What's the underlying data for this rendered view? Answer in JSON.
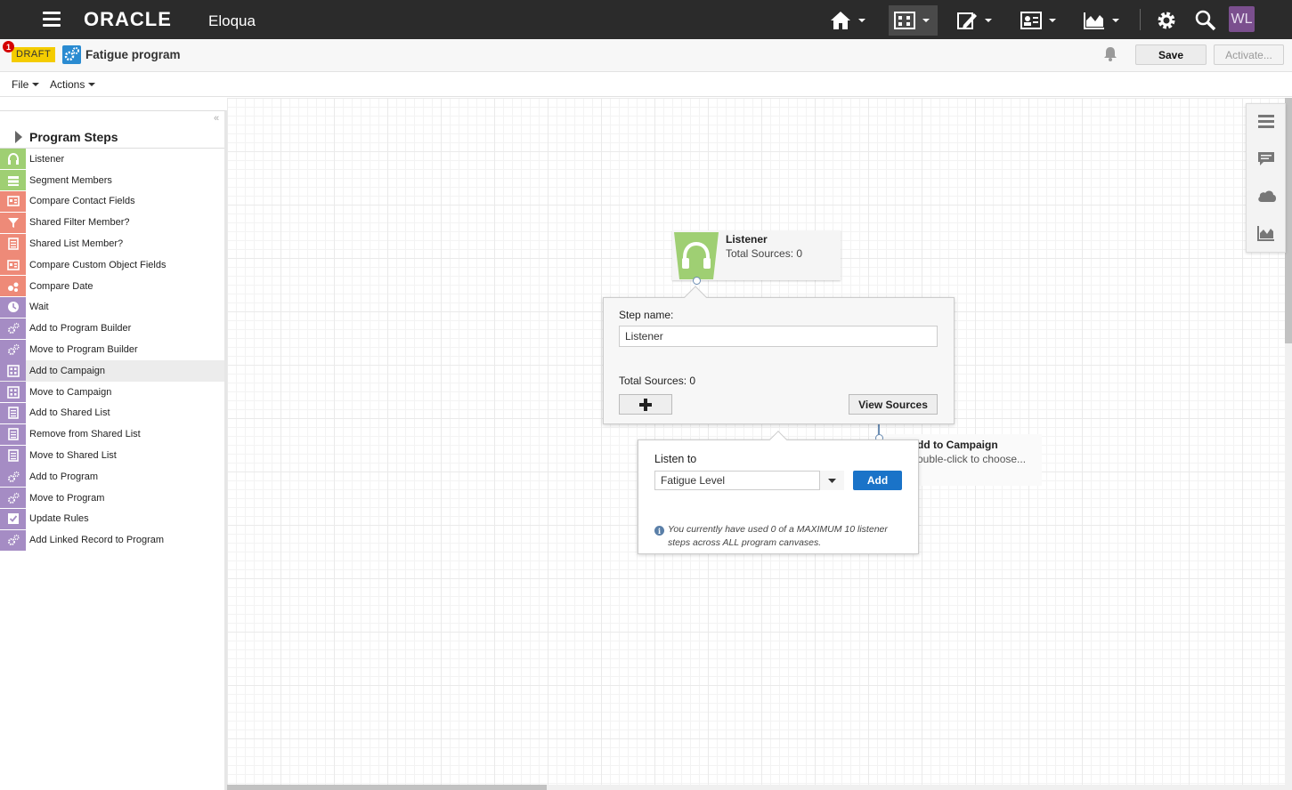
{
  "topbar": {
    "brand": "ORACLE",
    "product": "Eloqua",
    "avatar_initials": "WL"
  },
  "header": {
    "notification_count": "1",
    "status_badge": "DRAFT",
    "program_title": "Fatigue program",
    "save_label": "Save",
    "activate_label": "Activate..."
  },
  "menubar": {
    "file_label": "File",
    "actions_label": "Actions"
  },
  "left_panel": {
    "collapse_glyph": "«",
    "title": "Program Steps",
    "steps": [
      {
        "label": "Listener",
        "color": "#9fcf73",
        "icon": "headphones-icon"
      },
      {
        "label": "Segment Members",
        "color": "#9fcf73",
        "icon": "segment-icon"
      },
      {
        "label": "Compare Contact Fields",
        "color": "#ee8a78",
        "icon": "compare-fields-icon"
      },
      {
        "label": "Shared Filter Member?",
        "color": "#ee8a78",
        "icon": "filter-icon"
      },
      {
        "label": "Shared List Member?",
        "color": "#ee8a78",
        "icon": "list-icon"
      },
      {
        "label": "Compare Custom Object Fields",
        "color": "#ee8a78",
        "icon": "compare-fields-icon"
      },
      {
        "label": "Compare Date",
        "color": "#ee8a78",
        "icon": "date-icon"
      },
      {
        "label": "Wait",
        "color": "#a58cc4",
        "icon": "clock-icon"
      },
      {
        "label": "Add to Program Builder",
        "color": "#a58cc4",
        "icon": "program-icon"
      },
      {
        "label": "Move to Program Builder",
        "color": "#a58cc4",
        "icon": "program-icon"
      },
      {
        "label": "Add to Campaign",
        "color": "#a58cc4",
        "icon": "campaign-icon"
      },
      {
        "label": "Move to Campaign",
        "color": "#a58cc4",
        "icon": "campaign-icon"
      },
      {
        "label": "Add to Shared List",
        "color": "#a58cc4",
        "icon": "list-icon"
      },
      {
        "label": "Remove from Shared List",
        "color": "#a58cc4",
        "icon": "list-icon"
      },
      {
        "label": "Move to Shared List",
        "color": "#a58cc4",
        "icon": "list-icon"
      },
      {
        "label": "Add to Program",
        "color": "#a58cc4",
        "icon": "program-icon"
      },
      {
        "label": "Move to Program",
        "color": "#a58cc4",
        "icon": "program-icon"
      },
      {
        "label": "Update Rules",
        "color": "#a58cc4",
        "icon": "checklist-icon"
      },
      {
        "label": "Add Linked Record to Program",
        "color": "#a58cc4",
        "icon": "program-icon"
      }
    ]
  },
  "canvas": {
    "listener_node": {
      "title": "Listener",
      "subtitle": "Total Sources: 0"
    },
    "campaign_node": {
      "title": "dd to Campaign",
      "subtitle": "ouble-click to choose..."
    }
  },
  "details_popup": {
    "step_name_label": "Step name:",
    "step_name_value": "Listener",
    "total_sources_label": "Total Sources: 0",
    "view_sources_label": "View Sources"
  },
  "listen_popup": {
    "label": "Listen to",
    "selected_value": "Fatigue Level",
    "add_label": "Add",
    "info_text": "You currently have used 0 of a MAXIMUM 10 listener steps across ALL program canvases."
  },
  "colors": {
    "topbar": "#2b2b2b",
    "draft": "#f4cc00",
    "primary_button": "#1a73c8",
    "listener_green": "#9fcf73"
  }
}
